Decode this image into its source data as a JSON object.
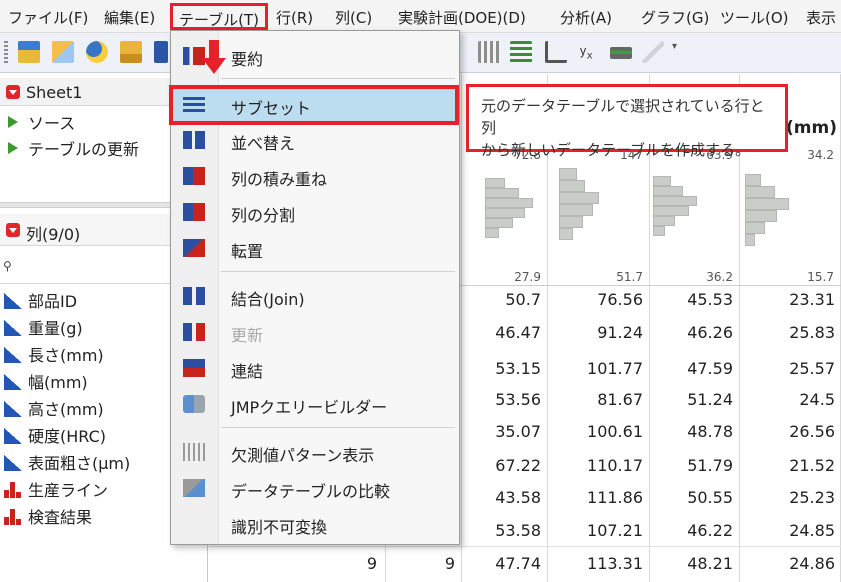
{
  "menubar": {
    "items": [
      "ファイル(F)",
      "編集(E)",
      "テーブル(T)",
      "行(R)",
      "列(C)",
      "実験計画(DOE)(D)",
      "分析(A)",
      "グラフ(G)",
      "ツール(O)",
      "表示"
    ]
  },
  "table_panel": {
    "title": "Sheet1",
    "scripts": [
      "ソース",
      "テーブルの更新"
    ]
  },
  "columns_panel": {
    "title": "列(9/0)",
    "columns": [
      "部品ID",
      "重量(g)",
      "長さ(mm)",
      "幅(mm)",
      "高さ(mm)",
      "硬度(HRC)",
      "表面粗さ(μm)",
      "生産ライン",
      "検査結果"
    ]
  },
  "dropdown": {
    "items": [
      {
        "label": "要約",
        "icon": "summary-icon"
      },
      {
        "label": "サブセット",
        "icon": "subset-icon"
      },
      {
        "label": "並べ替え",
        "icon": "sort-icon"
      },
      {
        "label": "列の積み重ね",
        "icon": "stack-icon"
      },
      {
        "label": "列の分割",
        "icon": "split-icon"
      },
      {
        "label": "転置",
        "icon": "transpose-icon"
      },
      {
        "label": "結合(Join)",
        "icon": "join-icon"
      },
      {
        "label": "更新",
        "icon": "update-icon"
      },
      {
        "label": "連結",
        "icon": "concatenate-icon"
      },
      {
        "label": "JMPクエリービルダー",
        "icon": "query-builder-icon"
      },
      {
        "label": "欠測値パターン表示",
        "icon": "missing-pattern-icon"
      },
      {
        "label": "データテーブルの比較",
        "icon": "compare-tables-icon"
      },
      {
        "label": "識別不可変換",
        "icon": "anonymize-icon"
      }
    ]
  },
  "tooltip": {
    "text_line1": "元のデータテーブルで選択されている行と列",
    "text_line2": "から新しいデータテーブルを作成する。"
  },
  "grid": {
    "header_partial": "(mm)",
    "histograms": [
      {
        "max": "72.8",
        "min": "27.9"
      },
      {
        "max": "147",
        "min": "51.7"
      },
      {
        "max": "63.9",
        "min": "36.2"
      },
      {
        "max": "34.2",
        "min": "15.7"
      }
    ],
    "rows": [
      [
        "50.7",
        "76.56",
        "45.53",
        "23.31"
      ],
      [
        "46.47",
        "91.24",
        "46.26",
        "25.83"
      ],
      [
        "53.15",
        "101.77",
        "47.59",
        "25.57"
      ],
      [
        "53.56",
        "81.67",
        "51.24",
        "24.5"
      ],
      [
        "35.07",
        "100.61",
        "48.78",
        "26.56"
      ],
      [
        "67.22",
        "110.17",
        "51.79",
        "21.52"
      ],
      [
        "43.58",
        "111.86",
        "50.55",
        "25.23"
      ],
      [
        "53.58",
        "107.21",
        "46.22",
        "24.85"
      ],
      [
        "47.74",
        "113.31",
        "48.21",
        "24.86"
      ]
    ],
    "last_row_extra": [
      "9",
      "9"
    ]
  },
  "colors": {
    "accent_red": "#e8202a",
    "highlight": "#bcdcef",
    "continuous_blue": "#2656b5",
    "nominal_red": "#c8231c"
  }
}
